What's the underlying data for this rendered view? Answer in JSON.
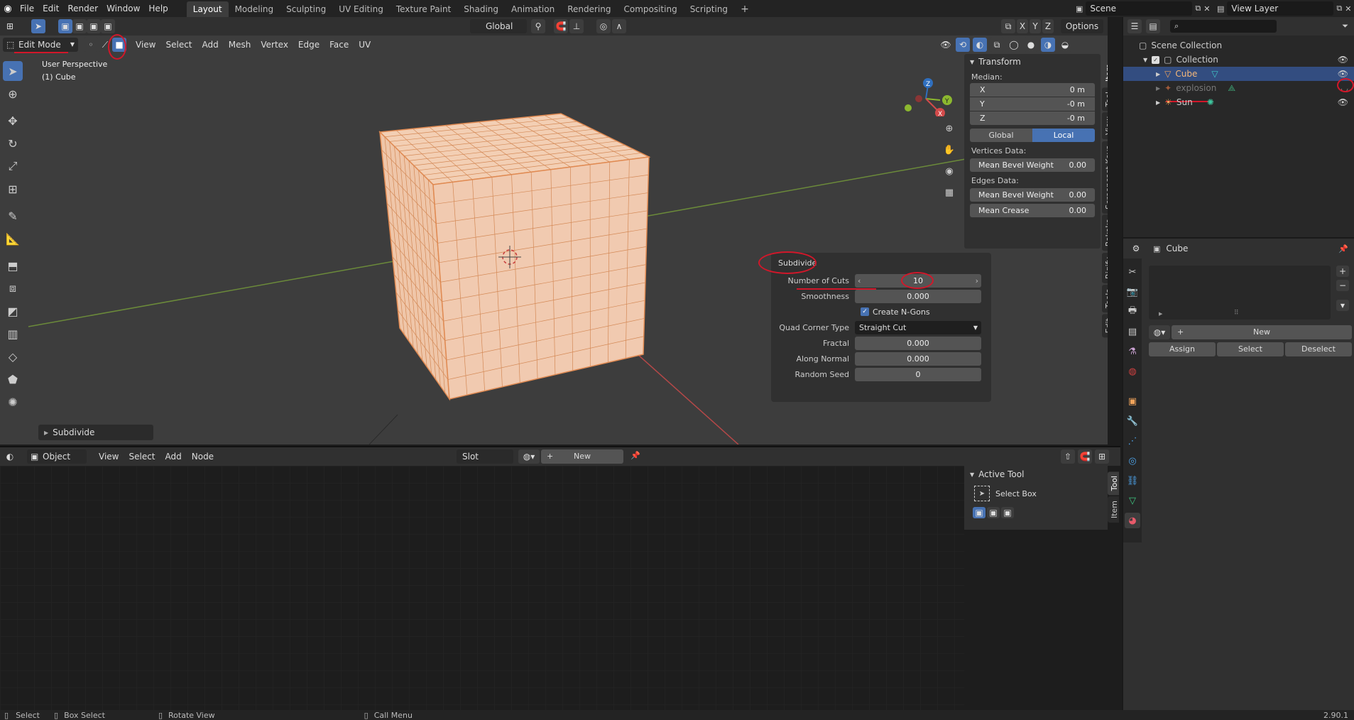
{
  "app": {
    "version": "2.90.1"
  },
  "topbar": {
    "menus": [
      "File",
      "Edit",
      "Render",
      "Window",
      "Help"
    ],
    "workspaces": [
      "Layout",
      "Modeling",
      "Sculpting",
      "UV Editing",
      "Texture Paint",
      "Shading",
      "Animation",
      "Rendering",
      "Compositing",
      "Scripting"
    ],
    "active_workspace": "Layout",
    "add_tab": "+",
    "scene": "Scene",
    "view_layer": "View Layer"
  },
  "viewport_header": {
    "mode": "Edit Mode",
    "menus": [
      "View",
      "Select",
      "Add",
      "Mesh",
      "Vertex",
      "Edge",
      "Face",
      "UV"
    ],
    "orientation": "Global",
    "options": "Options",
    "axes": [
      "X",
      "Y",
      "Z"
    ]
  },
  "viewport": {
    "perspective": "User Perspective",
    "object": "(1) Cube",
    "last_op": "Subdivide"
  },
  "transform": {
    "title": "Transform",
    "median": "Median:",
    "x_label": "X",
    "x": "0 m",
    "y_label": "Y",
    "y": "-0 m",
    "z_label": "Z",
    "z": "-0 m",
    "global": "Global",
    "local": "Local",
    "vertices_data": "Vertices Data:",
    "edges_data": "Edges Data:",
    "mean_bevel_weight": "Mean Bevel Weight",
    "mbw_v": "0.00",
    "mbw_e": "0.00",
    "mean_crease": "Mean Crease",
    "mc": "0.00"
  },
  "sidebar_tabs": [
    "Item",
    "Tool",
    "View",
    "Screencast Keys",
    "Rokoko",
    "Rigify",
    "Tools",
    "Edit"
  ],
  "subdivide": {
    "title": "Subdivide",
    "rows": [
      {
        "label": "Number of Cuts",
        "value": "10"
      },
      {
        "label": "Smoothness",
        "value": "0.000"
      }
    ],
    "ngons": "Create N-Gons",
    "quad_label": "Quad Corner Type",
    "quad_value": "Straight Cut",
    "rows2": [
      {
        "label": "Fractal",
        "value": "0.000"
      },
      {
        "label": "Along Normal",
        "value": "0.000"
      },
      {
        "label": "Random Seed",
        "value": "0"
      }
    ]
  },
  "outliner": {
    "root": "Scene Collection",
    "collection": "Collection",
    "items": [
      {
        "name": "Cube"
      },
      {
        "name": "explosion"
      },
      {
        "name": "Sun"
      }
    ]
  },
  "properties": {
    "object": "Cube",
    "new": "New",
    "assign": "Assign",
    "select": "Select",
    "deselect": "Deselect"
  },
  "shader_header": {
    "object": "Object",
    "menus": [
      "View",
      "Select",
      "Add",
      "Node"
    ],
    "slot": "Slot",
    "new": "New"
  },
  "active_tool": {
    "title": "Active Tool",
    "tool": "Select Box",
    "tabs": [
      "Tool",
      "Item"
    ]
  },
  "statusbar": {
    "select": "Select",
    "box_select": "Box Select",
    "rotate": "Rotate View",
    "call_menu": "Call Menu"
  },
  "colors": {
    "accent": "#4772b3",
    "selected_mesh": "#f0c5a8",
    "annotation": "#d2172a"
  }
}
